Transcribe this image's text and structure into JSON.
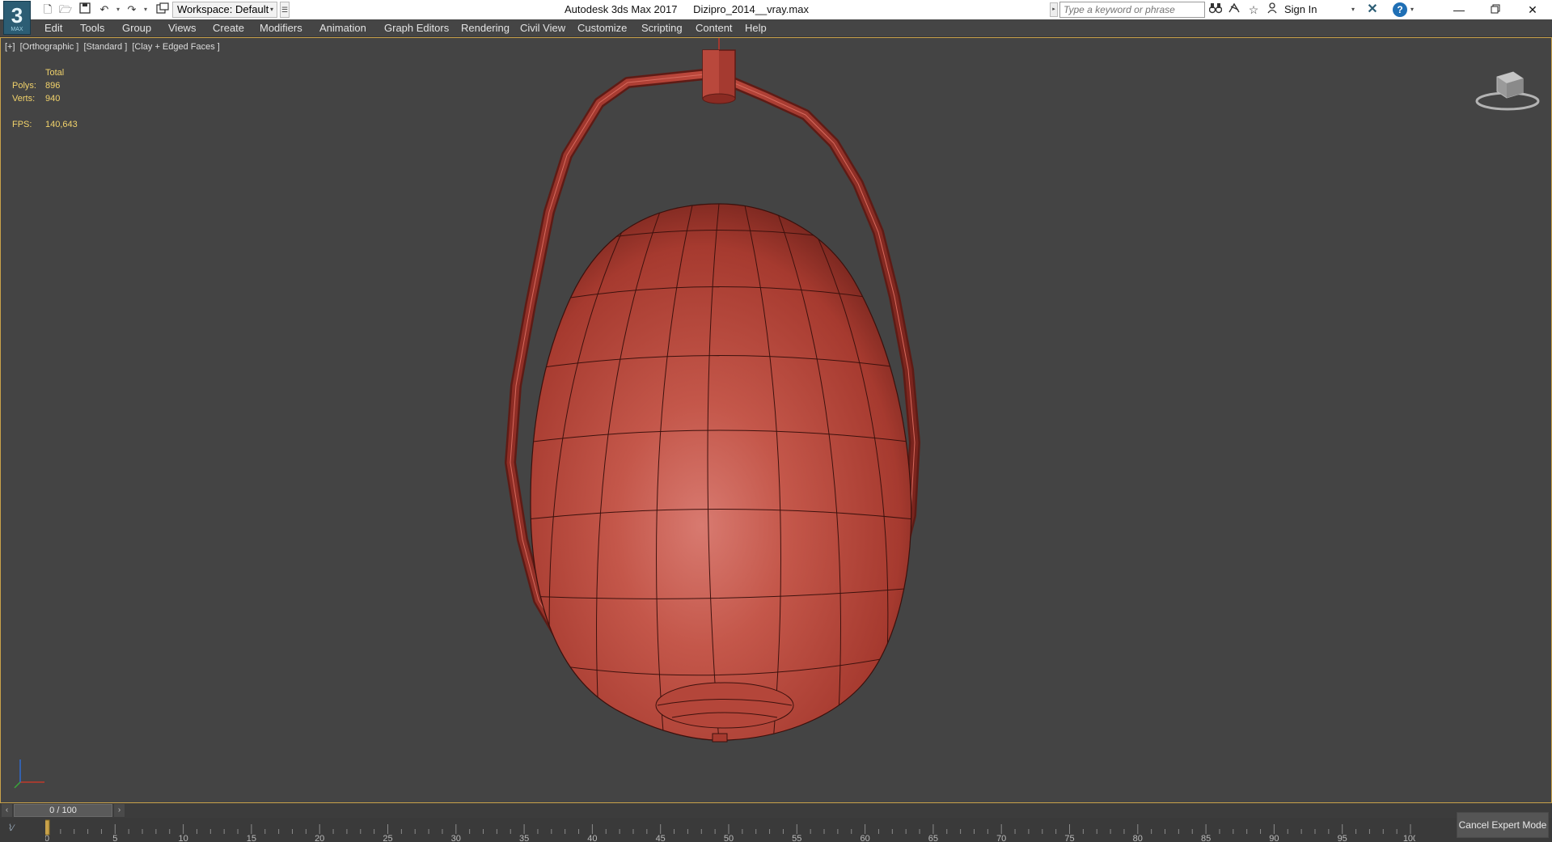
{
  "titlebar": {
    "logo_text": "3",
    "logo_sub": "MAX",
    "workspace_label": "Workspace: Default",
    "app_name": "Autodesk 3ds Max 2017",
    "file_name": "Dizipro_2014__vray.max",
    "search_placeholder": "Type a keyword or phrase",
    "sign_in": "Sign In"
  },
  "menu": [
    "Edit",
    "Tools",
    "Group",
    "Views",
    "Create",
    "Modifiers",
    "Animation",
    "Graph Editors",
    "Rendering",
    "Civil View",
    "Customize",
    "Scripting",
    "Content",
    "Help"
  ],
  "viewport": {
    "labels": [
      "[+]",
      "[Orthographic ]",
      "[Standard ]",
      "[Clay + Edged Faces ]"
    ],
    "stats": {
      "total_label": "Total",
      "polys_label": "Polys:",
      "polys_value": "896",
      "verts_label": "Verts:",
      "verts_value": "940",
      "fps_label": "FPS:",
      "fps_value": "140,643"
    },
    "model_color": "#b8473a",
    "background_color": "#444444",
    "active_border_color": "#c9a24a"
  },
  "timeline": {
    "slider_label": "0 / 100",
    "current_frame": 0,
    "total_frames": 100,
    "tick_labels": [
      "0",
      "5",
      "10",
      "15",
      "20",
      "25",
      "30",
      "35",
      "40",
      "45",
      "50",
      "55",
      "60",
      "65",
      "70",
      "75",
      "80",
      "85",
      "90",
      "95",
      "100"
    ]
  },
  "status": {
    "cancel_expert_mode": "Cancel Expert Mode"
  },
  "icons": [
    "new-file-icon",
    "open-file-icon",
    "save-icon",
    "undo-icon",
    "redo-icon",
    "project-icon",
    "binoculars-icon",
    "star-icon",
    "user-icon",
    "x-icon",
    "help-icon",
    "minimize-icon",
    "restore-icon",
    "close-icon",
    "viewcube-icon",
    "axis-tripod-icon"
  ]
}
